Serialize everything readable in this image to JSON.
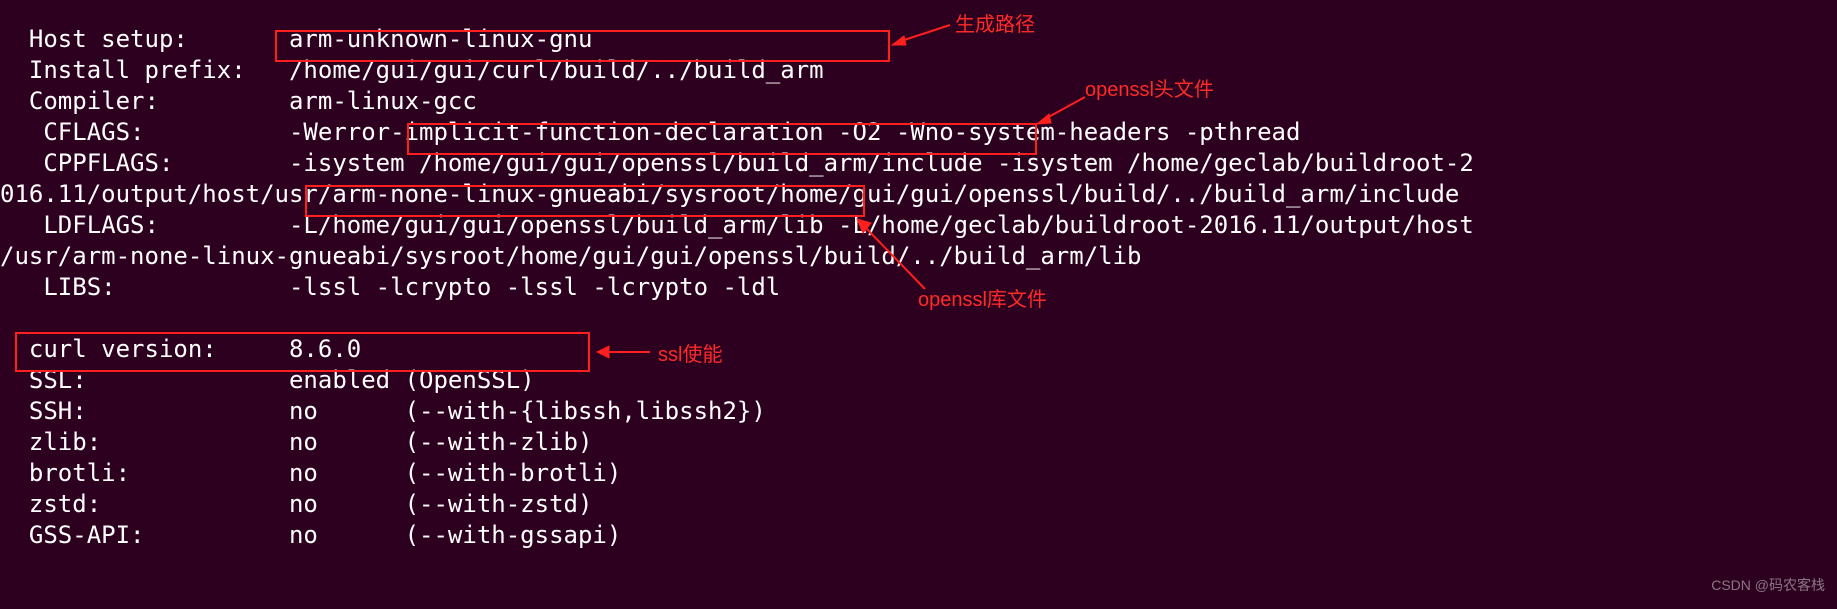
{
  "lines": {
    "l0": "  Host setup:       arm-unknown-linux-gnu",
    "l1": "  Install prefix:   /home/gui/gui/curl/build/../build_arm",
    "l2": "  Compiler:         arm-linux-gcc",
    "l3": "   CFLAGS:          -Werror-implicit-function-declaration -O2 -Wno-system-headers -pthread",
    "l4": "   CPPFLAGS:        -isystem /home/gui/gui/openssl/build_arm/include -isystem /home/geclab/buildroot-2",
    "l5": "016.11/output/host/usr/arm-none-linux-gnueabi/sysroot/home/gui/gui/openssl/build/../build_arm/include",
    "l6": "   LDFLAGS:         -L/home/gui/gui/openssl/build_arm/lib -L/home/geclab/buildroot-2016.11/output/host",
    "l7": "/usr/arm-none-linux-gnueabi/sysroot/home/gui/gui/openssl/build/../build_arm/lib",
    "l8": "   LIBS:            -lssl -lcrypto -lssl -lcrypto -ldl",
    "l9": "",
    "l10": "  curl version:     8.6.0",
    "l11": "  SSL:              enabled (OpenSSL)",
    "l12": "  SSH:              no      (--with-{libssh,libssh2})",
    "l13": "  zlib:             no      (--with-zlib)",
    "l14": "  brotli:           no      (--with-brotli)",
    "l15": "  zstd:             no      (--with-zstd)",
    "l16": "  GSS-API:          no      (--with-gssapi)"
  },
  "annotations": {
    "a1": "生成路径",
    "a2": "openssl头文件",
    "a3": "openssl库文件",
    "a4": "ssl使能"
  },
  "watermark": "CSDN @码农客栈"
}
